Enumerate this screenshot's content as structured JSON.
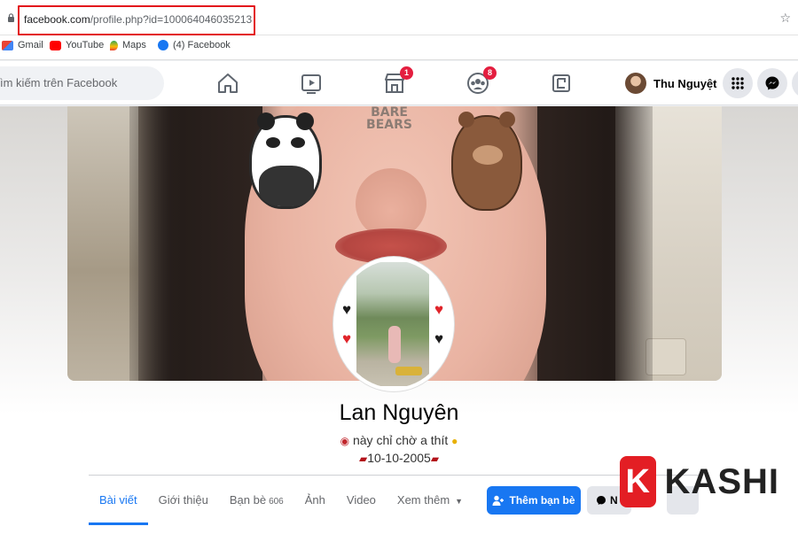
{
  "browser": {
    "url_domain": "facebook.com",
    "url_path": "/profile.php?id=100064046035213",
    "bookmarks": [
      {
        "label": "Gmail",
        "icon": "gmail-icon"
      },
      {
        "label": "YouTube",
        "icon": "youtube-icon"
      },
      {
        "label": "Maps",
        "icon": "maps-icon"
      },
      {
        "label": "(4) Facebook",
        "icon": "facebook-icon"
      }
    ]
  },
  "nav": {
    "search_placeholder": "ìm kiếm trên Facebook",
    "marketplace_badge": "1",
    "groups_badge": "8",
    "user_name": "Thu Nguyệt"
  },
  "profile": {
    "name": "Lan Nguyên",
    "bio_line1": "này chỉ chờ a thít",
    "bio_line2": "10-10-2005",
    "cover_sticker_text": "BARE BEARS"
  },
  "tabs": [
    {
      "label": "Bài viết",
      "active": true
    },
    {
      "label": "Giới thiệu",
      "active": false
    },
    {
      "label": "Bạn bè",
      "count": "606",
      "active": false
    },
    {
      "label": "Ảnh",
      "active": false
    },
    {
      "label": "Video",
      "active": false
    },
    {
      "label": "Xem thêm",
      "active": false
    }
  ],
  "actions": {
    "add_friend": "Thêm bạn bè",
    "message": "N"
  },
  "watermark": {
    "mark": "K",
    "text": "KASHI"
  },
  "colors": {
    "fb_blue": "#1877f2",
    "badge_red": "#e41e3f",
    "highlight_red": "#e3161c",
    "watermark_red": "#e31e24"
  }
}
